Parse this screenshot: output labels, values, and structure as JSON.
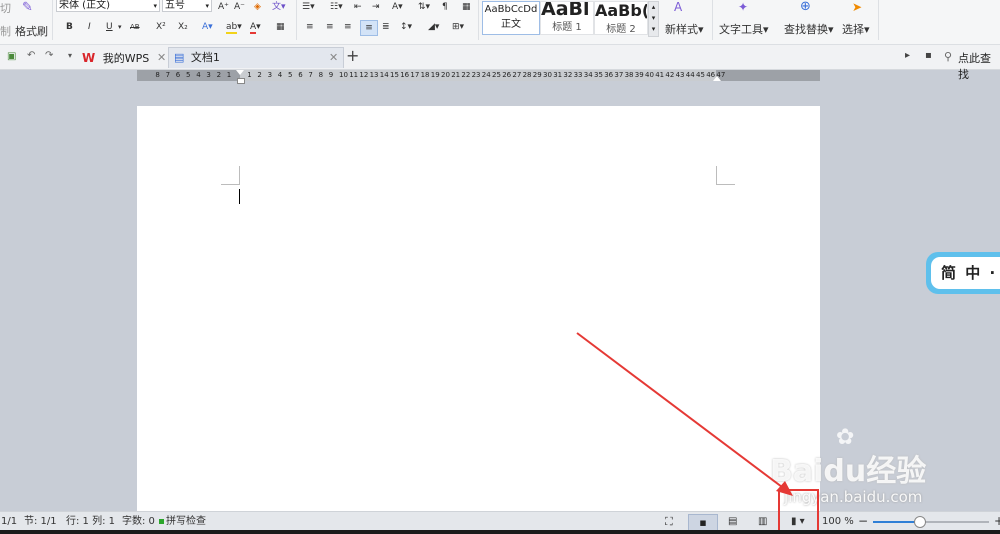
{
  "ribbon": {
    "cut_label": "切",
    "copy_label": "制",
    "format_painter_label": "格式刷",
    "font_name": "宋体 (正文)",
    "font_size": "五号",
    "styles": [
      {
        "sample": "AaBbCcDd",
        "name": "正文"
      },
      {
        "sample": "AaBl",
        "name": "标题 1"
      },
      {
        "sample": "AaBb(",
        "name": "标题 2"
      }
    ],
    "new_style_label": "新样式",
    "text_tools_label": "文字工具",
    "find_replace_label": "查找替换",
    "select_label": "选择",
    "bold": "B",
    "italic": "I",
    "underline": "U",
    "strike": "AB",
    "superscript": "X²",
    "subscript": "X₂",
    "grow_font": "A⁺",
    "shrink_font": "A⁻"
  },
  "tabs": {
    "wps_tab": "我的WPS",
    "doc_tab": "文档1",
    "search_label": "点此查找"
  },
  "ruler": {
    "left_numbers": [
      "8",
      "7",
      "6",
      "5",
      "4",
      "3",
      "2",
      "1"
    ],
    "right_numbers": [
      "1",
      "2",
      "3",
      "4",
      "5",
      "6",
      "7",
      "8",
      "9",
      "10",
      "11",
      "12",
      "13",
      "14",
      "15",
      "16",
      "17",
      "18",
      "19",
      "20",
      "21",
      "22",
      "23",
      "24",
      "25",
      "26",
      "27",
      "28",
      "29",
      "30",
      "31",
      "32",
      "33",
      "34",
      "35",
      "36",
      "37",
      "38",
      "39",
      "40",
      "41",
      "42",
      "43",
      "44",
      "45",
      "46",
      "47"
    ]
  },
  "float_panel": {
    "text": "简 中 ·"
  },
  "status": {
    "page": "1/1",
    "section": "节: 1/1",
    "position": "行: 1   列: 1",
    "word_count": "字数: 0",
    "spell_check": "拼写检查",
    "zoom": "100 %",
    "zoom_level_fraction": 0.4
  },
  "watermark": {
    "brand": "Baidu经验",
    "url": "jingyan.baidu.com"
  },
  "colors": {
    "accent": "#2f7fd6",
    "annotation": "#e53935"
  }
}
